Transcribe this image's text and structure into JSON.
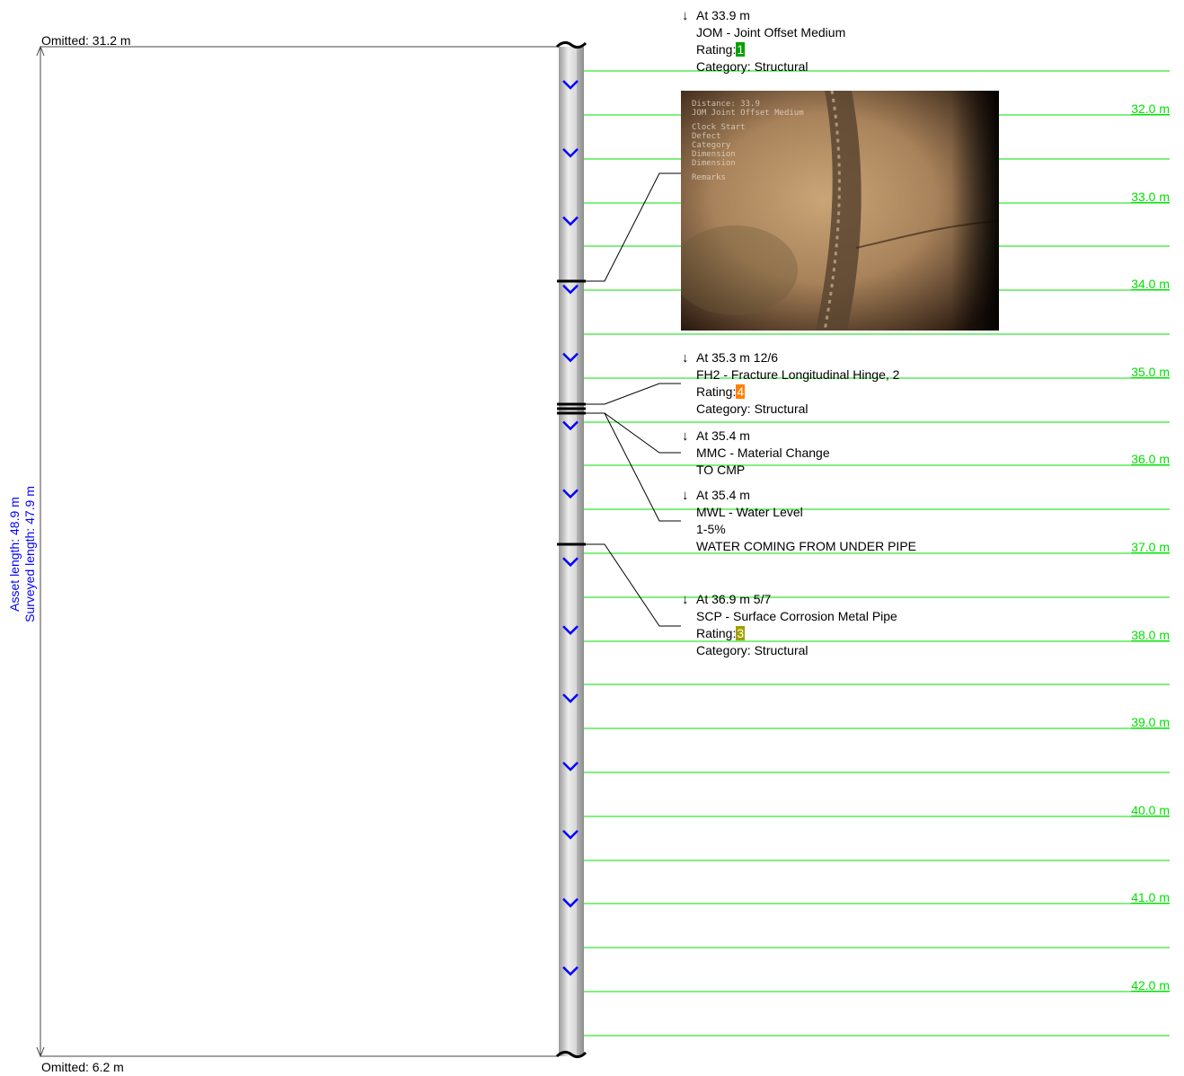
{
  "omitted_top": "Omitted: 31.2 m",
  "omitted_bottom": "Omitted: 6.2 m",
  "asset_length": "Asset length: 48.9 m",
  "surveyed_length": "Surveyed length: 47.9 m",
  "distance_markers": [
    "32.0 m",
    "33.0 m",
    "34.0 m",
    "35.0 m",
    "36.0 m",
    "37.0 m",
    "38.0 m",
    "39.0 m",
    "40.0 m",
    "41.0 m",
    "42.0 m"
  ],
  "observations": [
    {
      "position_m": 33.9,
      "lines": [
        "At 33.9 m",
        "JOM - Joint Offset Medium",
        "Category: Structural"
      ],
      "rating_label": "Rating:",
      "rating": "1",
      "rating_color": "#00a000"
    },
    {
      "position_m": 35.3,
      "lines": [
        "At 35.3 m 12/6",
        "FH2 - Fracture Longitudinal Hinge, 2",
        "Category: Structural"
      ],
      "rating_label": "Rating:",
      "rating": "4",
      "rating_color": "#ff8000"
    },
    {
      "position_m": 35.4,
      "lines": [
        "At 35.4 m",
        "MMC - Material Change",
        "TO CMP"
      ]
    },
    {
      "position_m": 35.4,
      "lines": [
        "At 35.4 m",
        "MWL - Water Level",
        "1-5%",
        "WATER COMING FROM UNDER PIPE"
      ]
    },
    {
      "position_m": 36.9,
      "lines": [
        "At 36.9 m 5/7",
        "SCP - Surface Corrosion Metal Pipe",
        "Category: Structural"
      ],
      "rating_label": "Rating:",
      "rating": "3",
      "rating_color": "#a0a000"
    }
  ],
  "photo_overlay_text": [
    "Distance: 33.9",
    "JOM Joint Offset Medium",
    "Clock Start",
    "Defect",
    "Category",
    "Dimension",
    "Dimension",
    "Remarks"
  ],
  "colors": {
    "grid": "#00e000",
    "flow_arrow": "#0000ff",
    "pipe": "#c8c8c8",
    "accent": "#0000ff"
  },
  "icons": {
    "flow": "chevron-down-icon",
    "observation": "down-arrow-icon"
  }
}
